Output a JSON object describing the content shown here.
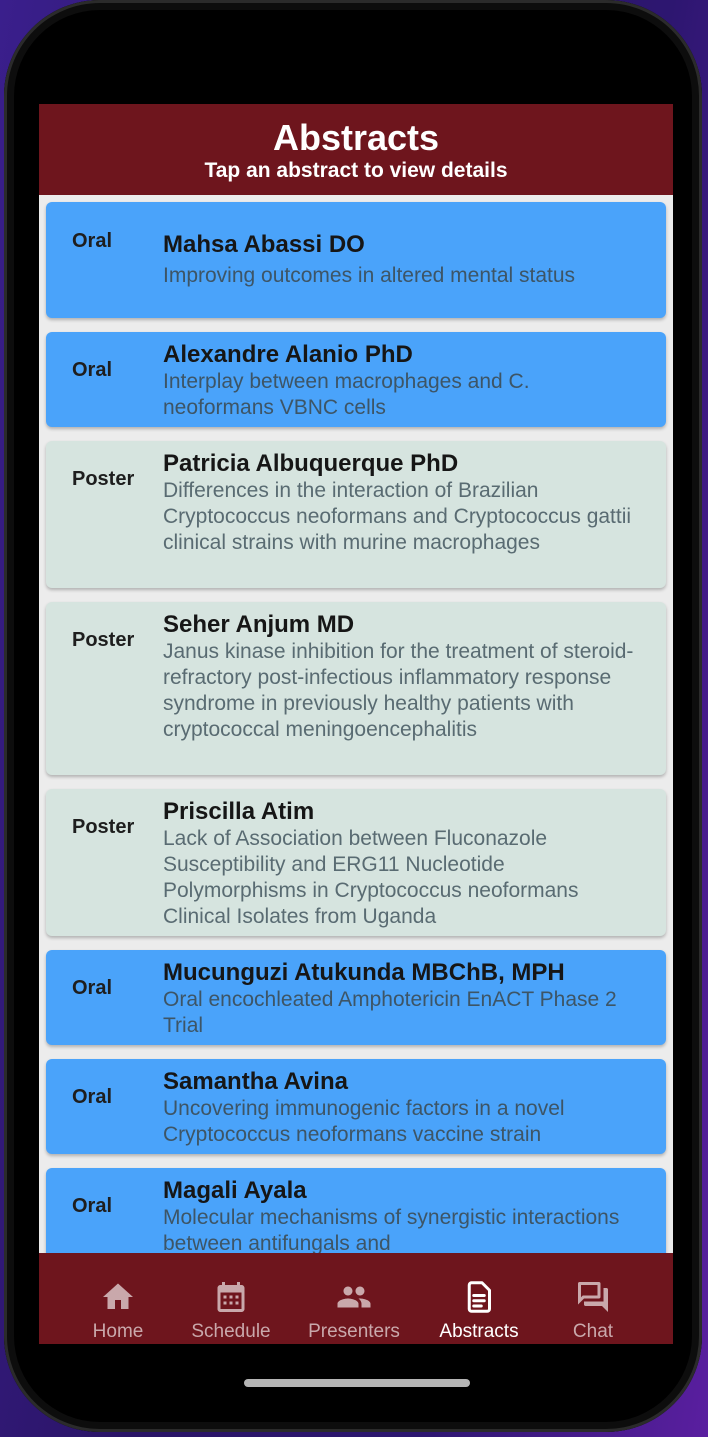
{
  "header": {
    "title": "Abstracts",
    "subtitle": "Tap an abstract to view details"
  },
  "abstracts": [
    {
      "type": "Oral",
      "name": "Mahsa Abassi DO",
      "title": "Improving outcomes in altered mental status"
    },
    {
      "type": "Oral",
      "name": "Alexandre Alanio PhD",
      "title": "Interplay between macrophages and C. neoformans VBNC cells"
    },
    {
      "type": "Poster",
      "name": "Patricia Albuquerque PhD",
      "title": "Differences in the interaction of Brazilian Cryptococcus neoformans and Cryptococcus gattii clinical strains with murine macrophages"
    },
    {
      "type": "Poster",
      "name": "Seher Anjum MD",
      "title": "Janus kinase inhibition for the treatment of steroid-refractory post-infectious inflammatory response syndrome in previously healthy patients with cryptococcal meningoencephalitis"
    },
    {
      "type": "Poster",
      "name": "Priscilla Atim",
      "title": "Lack of Association between Fluconazole Susceptibility and ERG11 Nucleotide Polymorphisms in Cryptococcus neoformans Clinical Isolates from Uganda"
    },
    {
      "type": "Oral",
      "name": "Mucunguzi Atukunda MBChB, MPH",
      "title": "Oral encochleated Amphotericin EnACT Phase 2 Trial"
    },
    {
      "type": "Oral",
      "name": "Samantha Avina",
      "title": "Uncovering immunogenic factors in a novel Cryptococcus neoformans vaccine strain"
    },
    {
      "type": "Oral",
      "name": "Magali Ayala",
      "title": "Molecular mechanisms of synergistic interactions between antifungals and"
    }
  ],
  "tabs": [
    {
      "label": "Home",
      "icon": "home-icon"
    },
    {
      "label": "Schedule",
      "icon": "calendar-icon"
    },
    {
      "label": "Presenters",
      "icon": "people-icon"
    },
    {
      "label": "Abstracts",
      "icon": "document-icon",
      "active": true
    },
    {
      "label": "Chat",
      "icon": "chat-icon"
    }
  ],
  "colors": {
    "header_bg": "#6e151d",
    "oral_card": "#4aa3fa",
    "poster_card": "#d6e4df",
    "tab_active": "#ffffff",
    "tab_inactive": "#c9a8ab"
  }
}
